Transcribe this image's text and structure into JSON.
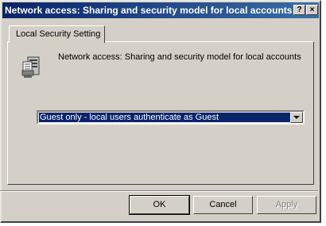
{
  "window": {
    "title": "Network access: Sharing and security model for local accounts...",
    "help_button": "?",
    "close_button": "×"
  },
  "tabs": [
    {
      "label": "Local Security Setting"
    }
  ],
  "policy": {
    "icon": "policy-settings-icon",
    "name": "Network access: Sharing and security model for local accounts"
  },
  "dropdown": {
    "selected": "Guest only - local users authenticate as Guest"
  },
  "buttons": {
    "ok": "OK",
    "cancel": "Cancel",
    "apply": "Apply"
  },
  "colors": {
    "title_bar": "#0a246a",
    "dialog_bg": "#d4d0c8",
    "selection": "#0a246a"
  }
}
